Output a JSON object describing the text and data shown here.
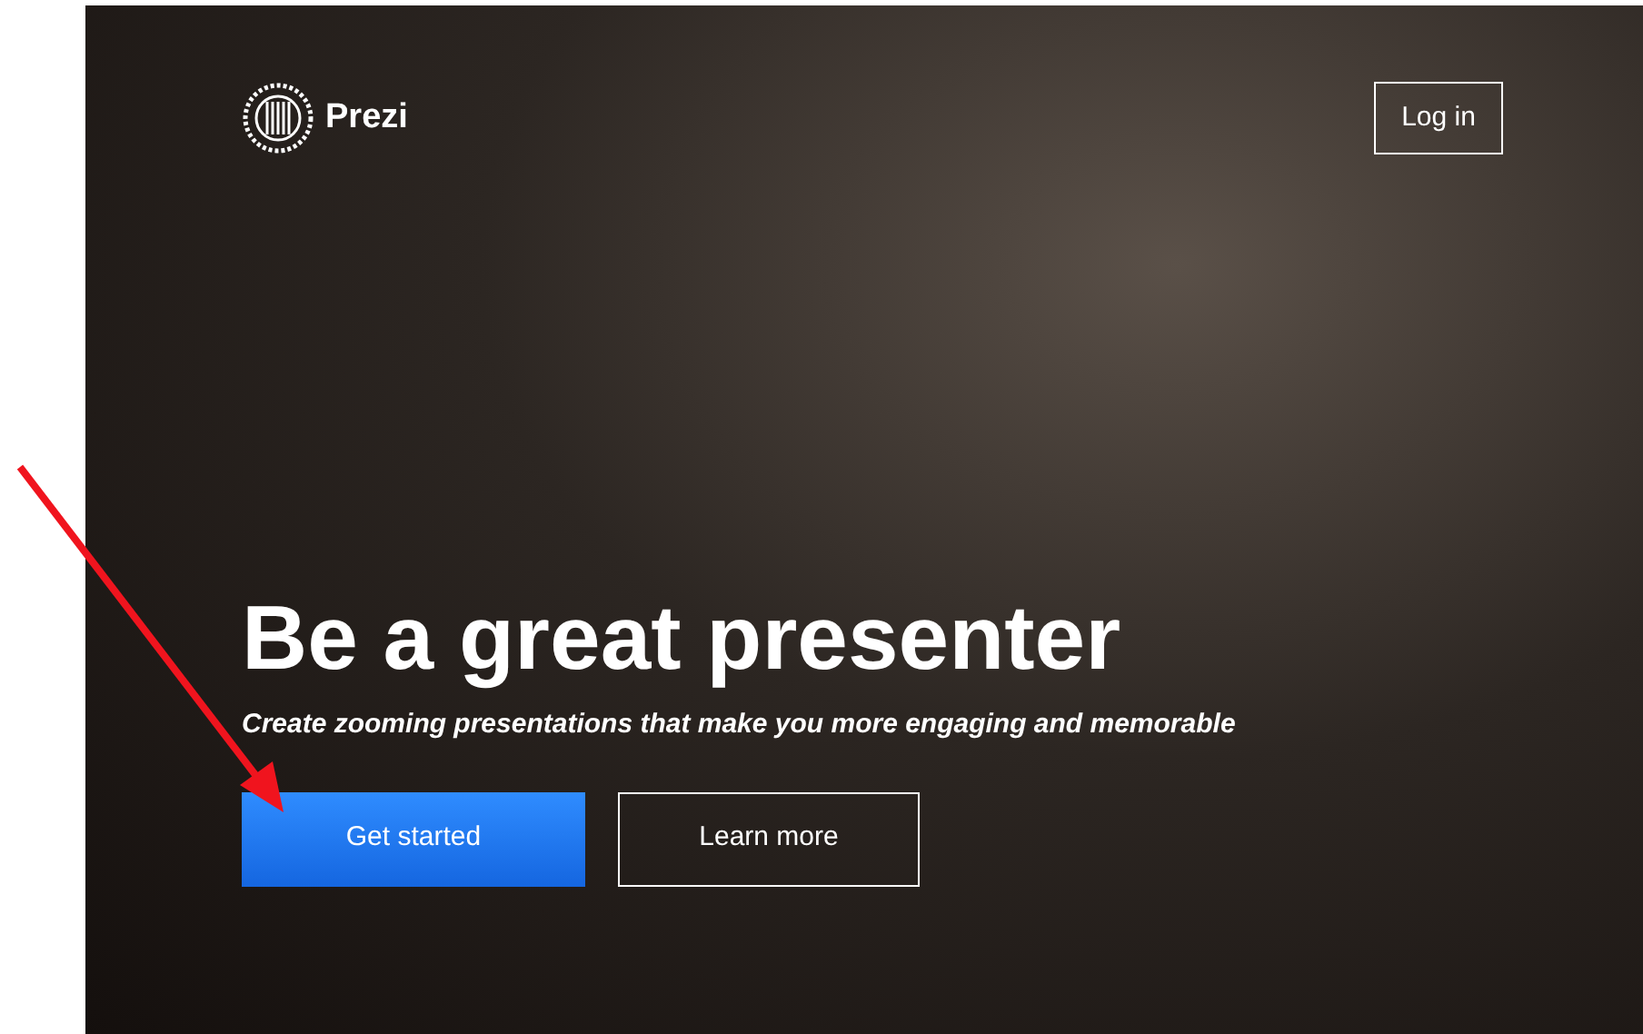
{
  "header": {
    "logo_text": "Prezi",
    "login_button": "Log in"
  },
  "hero": {
    "title": "Be a great presenter",
    "subtitle": "Create zooming presentations that make you more engaging and memorable"
  },
  "buttons": [
    {
      "label": "Get started",
      "kind": "primary"
    },
    {
      "label": "Learn more",
      "kind": "outline"
    }
  ]
}
